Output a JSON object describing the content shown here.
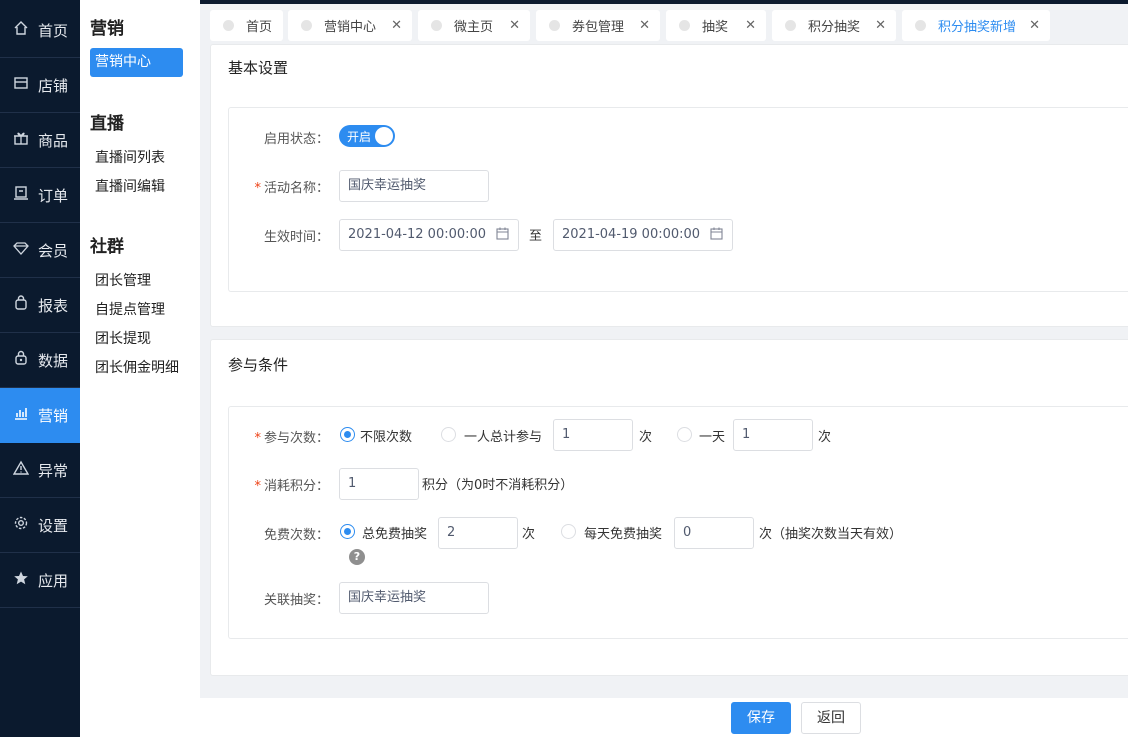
{
  "nav": [
    {
      "label": "首页",
      "icon": "home-icon"
    },
    {
      "label": "店铺",
      "icon": "store-icon"
    },
    {
      "label": "商品",
      "icon": "gift-icon"
    },
    {
      "label": "订单",
      "icon": "order-icon"
    },
    {
      "label": "会员",
      "icon": "diamond-icon"
    },
    {
      "label": "报表",
      "icon": "bag-icon"
    },
    {
      "label": "数据",
      "icon": "lock-bag-icon"
    },
    {
      "label": "营销",
      "icon": "bar-chart-icon",
      "active": true
    },
    {
      "label": "异常",
      "icon": "warning-icon"
    },
    {
      "label": "设置",
      "icon": "gear-icon"
    },
    {
      "label": "应用",
      "icon": "star-icon"
    }
  ],
  "sub": {
    "marketing_title": "营销",
    "marketing_center": "营销中心",
    "live_title": "直播",
    "live_list": "直播间列表",
    "live_edit": "直播间编辑",
    "community_title": "社群",
    "community_items": [
      "团长管理",
      "自提点管理",
      "团长提现",
      "团长佣金明细"
    ]
  },
  "tabs": [
    {
      "label": "首页",
      "closable": false
    },
    {
      "label": "营销中心",
      "closable": true
    },
    {
      "label": "微主页",
      "closable": true
    },
    {
      "label": "券包管理",
      "closable": true
    },
    {
      "label": "抽奖",
      "closable": true
    },
    {
      "label": "积分抽奖",
      "closable": true
    },
    {
      "label": "积分抽奖新增",
      "closable": true,
      "active": true
    }
  ],
  "basic": {
    "title": "基本设置",
    "status_label": "启用状态：",
    "status_switch": "开启",
    "name_label": "活动名称：",
    "name_value": "国庆幸运抽奖",
    "time_label": "生效时间：",
    "start_time": "2021-04-12 00:00:00",
    "to": "至",
    "end_time": "2021-04-19 00:00:00"
  },
  "condition": {
    "title": "参与条件",
    "times_label": "参与次数：",
    "opt_unlimited": "不限次数",
    "opt_total": "一人总计参与",
    "total_value": "1",
    "unit": "次",
    "opt_daily": "一天",
    "daily_value": "1",
    "points_label": "消耗积分：",
    "points_value": "1",
    "points_hint": "积分（为0时不消耗积分）",
    "free_label": "免费次数：",
    "opt_free_total": "总免费抽奖",
    "free_total_value": "2",
    "opt_free_daily": "每天免费抽奖",
    "free_daily_value": "0",
    "free_daily_hint": "次（抽奖次数当天有效）",
    "help": "?",
    "link_label": "关联抽奖：",
    "link_value": "国庆幸运抽奖"
  },
  "footer": {
    "save": "保存",
    "back": "返回"
  },
  "colors": {
    "primary": "#2d8cf0",
    "nav_bg": "#0b1a2e",
    "required": "#ed4014"
  }
}
